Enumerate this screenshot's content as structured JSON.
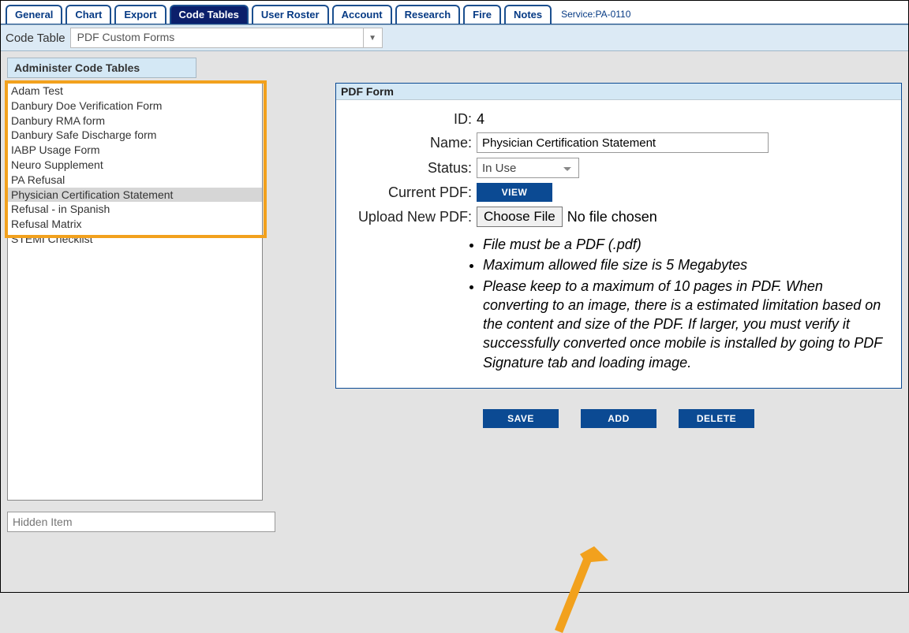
{
  "tabs": [
    "General",
    "Chart",
    "Export",
    "Code Tables",
    "User Roster",
    "Account",
    "Research",
    "Fire",
    "Notes"
  ],
  "active_tab": 3,
  "service_label": "Service:PA-0110",
  "codetable_label": "Code Table",
  "codetable_value": "PDF Custom Forms",
  "panel_title": "Administer Code Tables",
  "list_items": [
    "Adam Test",
    "Danbury Doe Verification Form",
    "Danbury RMA form",
    "Danbury Safe Discharge form",
    "IABP Usage Form",
    "Neuro Supplement",
    "PA Refusal",
    "Physician Certification Statement",
    "Refusal - in Spanish",
    "Refusal Matrix",
    "STEMI Checklist"
  ],
  "list_selected_index": 7,
  "hidden_placeholder": "Hidden Item",
  "pdf": {
    "panel_title": "PDF Form",
    "id_label": "ID:",
    "id_value": "4",
    "name_label": "Name:",
    "name_value": "Physician Certification Statement",
    "status_label": "Status:",
    "status_value": "In Use",
    "current_label": "Current PDF:",
    "view_btn": "VIEW",
    "upload_label": "Upload New PDF:",
    "choose_btn": "Choose File",
    "no_file": "No file chosen",
    "notes": [
      "File must be a PDF (.pdf)",
      "Maximum allowed file size is 5 Megabytes",
      "Please keep to a maximum of 10 pages in PDF. When converting to an image, there is a estimated limitation based on the content and size of the PDF. If larger, you must verify it successfully converted once mobile is installed by going to PDF Signature tab and loading image."
    ]
  },
  "buttons": {
    "save": "SAVE",
    "add": "ADD",
    "delete": "DELETE"
  }
}
